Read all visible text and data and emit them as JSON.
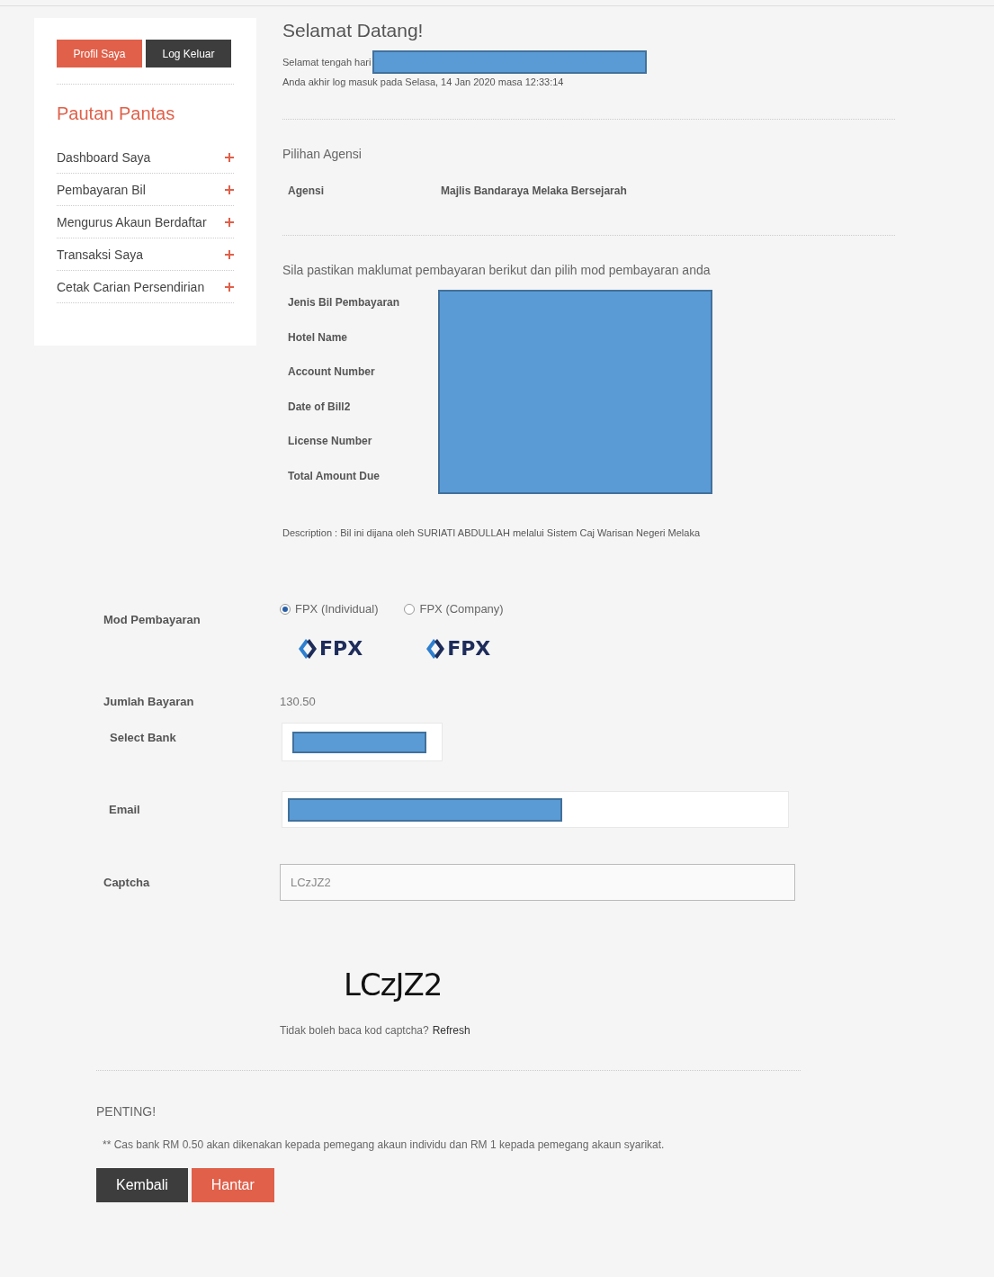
{
  "sidebar": {
    "buttons": [
      {
        "label": "Profil Saya",
        "kind": "primary"
      },
      {
        "label": "Log Keluar",
        "kind": "dark"
      }
    ],
    "title": "Pautan Pantas",
    "items": [
      {
        "label": "Dashboard Saya"
      },
      {
        "label": "Pembayaran Bil"
      },
      {
        "label": "Mengurus Akaun Berdaftar"
      },
      {
        "label": "Transaksi Saya"
      },
      {
        "label": "Cetak Carian Persendirian"
      }
    ]
  },
  "welcome": {
    "title": "Selamat Datang!",
    "greeting": "Selamat tengah hari",
    "last_login": "Anda akhir log masuk pada Selasa, 14 Jan 2020 masa 12:33:14"
  },
  "agency": {
    "heading": "Pilihan Agensi",
    "label": "Agensi",
    "value": "Majlis Bandaraya Melaka Bersejarah"
  },
  "bill": {
    "instruction": "Sila pastikan maklumat pembayaran berikut dan pilih mod pembayaran anda",
    "fields": [
      "Jenis Bil Pembayaran",
      "Hotel Name",
      "Account Number",
      "Date of Bill2",
      "License Number",
      "Total Amount Due"
    ],
    "description": "Description : Bil ini dijana oleh SURIATI ABDULLAH melalui Sistem Caj Warisan Negeri Melaka"
  },
  "payment": {
    "mode_label": "Mod Pembayaran",
    "modes": [
      {
        "label": "FPX (Individual)",
        "logo": "FPX",
        "selected": true
      },
      {
        "label": "FPX (Company)",
        "logo": "FPX",
        "selected": false
      }
    ],
    "amount_label": "Jumlah Bayaran",
    "amount": "130.50",
    "bank_label": "Select Bank",
    "email_label": "Email",
    "captcha_label": "Captcha",
    "captcha_value": "LCzJZ2",
    "captcha_image": "LCzJZ2",
    "refresh_text": "Tidak boleh baca kod captcha?",
    "refresh_link": "Refresh"
  },
  "notice": {
    "title": "PENTING!",
    "text": "** Cas bank RM 0.50 akan dikenakan kepada pemegang akaun individu dan RM 1 kepada pemegang akaun syarikat."
  },
  "actions": [
    {
      "label": "Kembali",
      "kind": "dark"
    },
    {
      "label": "Hantar",
      "kind": "primary"
    }
  ]
}
